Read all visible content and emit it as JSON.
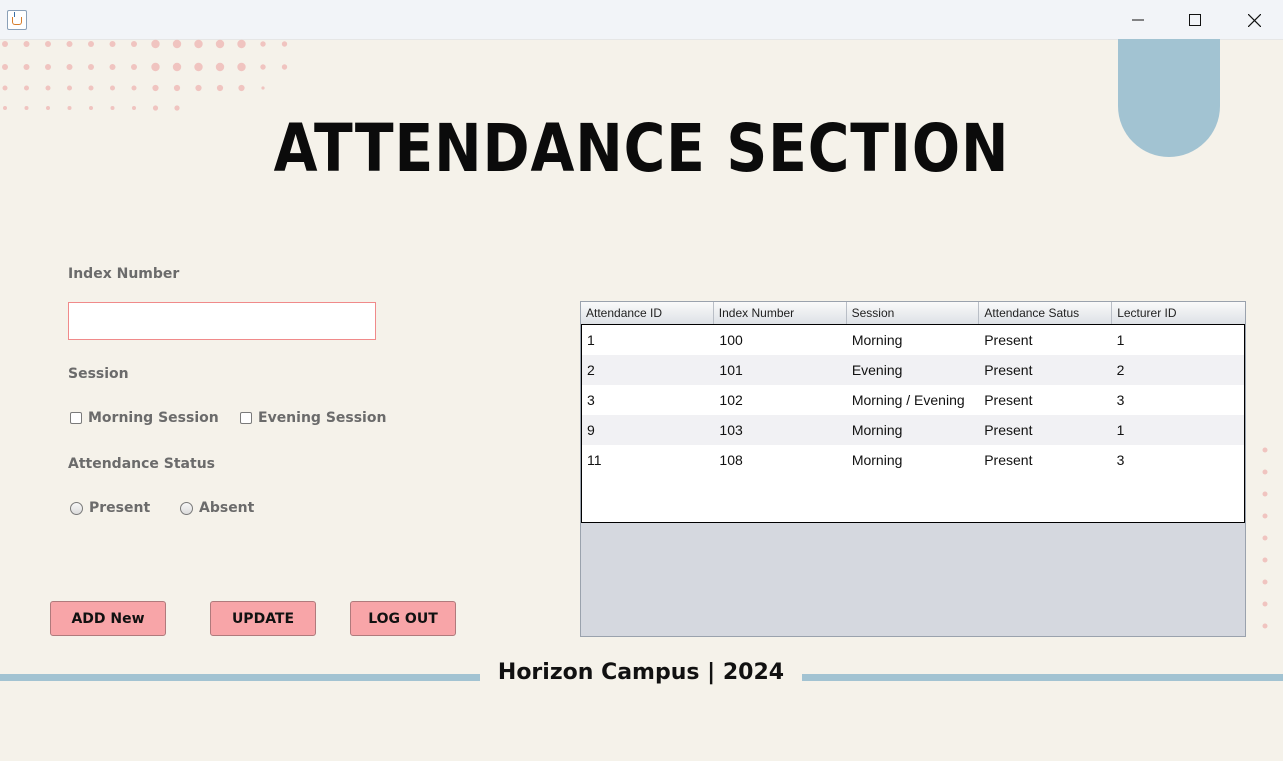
{
  "window": {
    "minimize_icon": "minimize-icon",
    "maximize_icon": "maximize-icon",
    "close_icon": "close-icon"
  },
  "title": "ATTENDANCE SECTION",
  "form": {
    "index_label": "Index Number",
    "index_value": "",
    "session_label": "Session",
    "morning_label": "Morning Session",
    "evening_label": "Evening Session",
    "status_label": "Attendance Status",
    "present_label": "Present",
    "absent_label": "Absent"
  },
  "buttons": {
    "add": "ADD New",
    "update": "UPDATE",
    "logout": "LOG OUT"
  },
  "table": {
    "columns": [
      "Attendance ID",
      "Index Number",
      "Session",
      "Attendance Satus",
      "Lecturer ID"
    ],
    "rows": [
      [
        "1",
        "100",
        "Morning",
        "Present",
        "1"
      ],
      [
        "2",
        "101",
        "Evening",
        "Present",
        "2"
      ],
      [
        "3",
        "102",
        "Morning / Evening",
        "Present",
        "3"
      ],
      [
        "9",
        "103",
        "Morning",
        "Present",
        "1"
      ],
      [
        "11",
        "108",
        "Morning",
        "Present",
        "3"
      ]
    ]
  },
  "footer": "Horizon Campus | 2024",
  "colors": {
    "background": "#f5f2ea",
    "accent_blue": "#a2c3d2",
    "button_pink": "#f8a5a8",
    "dot_pink": "#f0c4c0"
  }
}
